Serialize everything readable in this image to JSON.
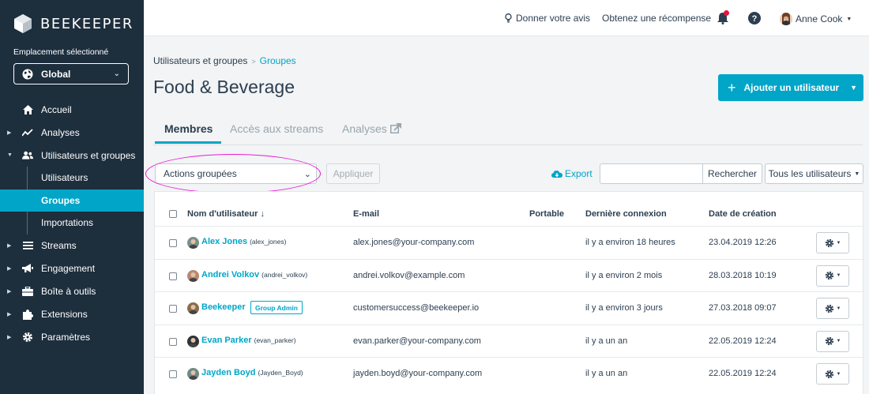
{
  "brand": {
    "name": "BEEKEEPER"
  },
  "location": {
    "label": "Emplacement sélectionné",
    "value": "Global"
  },
  "nav": {
    "home": "Accueil",
    "analytics": "Analyses",
    "users_groups": "Utilisateurs et groupes",
    "sub_users": "Utilisateurs",
    "sub_groups": "Groupes",
    "sub_imports": "Importations",
    "streams": "Streams",
    "engagement": "Engagement",
    "toolbox": "Boîte à outils",
    "extensions": "Extensions",
    "settings": "Paramètres"
  },
  "topbar": {
    "feedback": "Donner votre avis",
    "reward": "Obtenez une récompense",
    "user": "Anne Cook"
  },
  "breadcrumb": {
    "parent": "Utilisateurs et groupes",
    "separator": ">",
    "current": "Groupes"
  },
  "page": {
    "title": "Food & Beverage",
    "add_button": "Ajouter un utilisateur"
  },
  "tabs": {
    "members": "Membres",
    "stream_access": "Accès aux streams",
    "analytics": "Analyses"
  },
  "toolbar": {
    "bulk_actions": "Actions groupées",
    "apply": "Appliquer",
    "export": "Export",
    "search_placeholder": "",
    "search_button": "Rechercher",
    "filter": "Tous les utilisateurs"
  },
  "table": {
    "headers": {
      "username": "Nom d'utilisateur",
      "email": "E-mail",
      "mobile": "Portable",
      "last_login": "Dernière connexion",
      "created": "Date de création"
    },
    "rows": [
      {
        "name": "Alex Jones",
        "handle": "(alex_jones)",
        "badge": "",
        "email": "alex.jones@your-company.com",
        "last_login": "il y a environ 18 heures",
        "created": "23.04.2019 12:26",
        "avatar_color": "#7b8f8a"
      },
      {
        "name": "Andrei Volkov",
        "handle": "(andrei_volkov)",
        "badge": "",
        "email": "andrei.volkov@example.com",
        "last_login": "il y a environ 2 mois",
        "created": "28.03.2018 10:19",
        "avatar_color": "#b98770"
      },
      {
        "name": "Beekeeper",
        "handle": "",
        "badge": "Group Admin",
        "email": "customersuccess@beekeeper.io",
        "last_login": "il y a environ 3 jours",
        "created": "27.03.2018 09:07",
        "avatar_color": "#8a6b4a"
      },
      {
        "name": "Evan Parker",
        "handle": "(evan_parker)",
        "badge": "",
        "email": "evan.parker@your-company.com",
        "last_login": "il y a un an",
        "created": "22.05.2019 12:24",
        "avatar_color": "#2e3236"
      },
      {
        "name": "Jayden Boyd",
        "handle": "(Jayden_Boyd)",
        "badge": "",
        "email": "jayden.boyd@your-company.com",
        "last_login": "il y a un an",
        "created": "22.05.2019 12:24",
        "avatar_color": "#6f8a84"
      }
    ]
  },
  "colors": {
    "sidebar": "#1d2e3d",
    "accent": "#00a5c8",
    "highlight_ellipse": "#e81ad6",
    "notification": "#e3173e"
  }
}
